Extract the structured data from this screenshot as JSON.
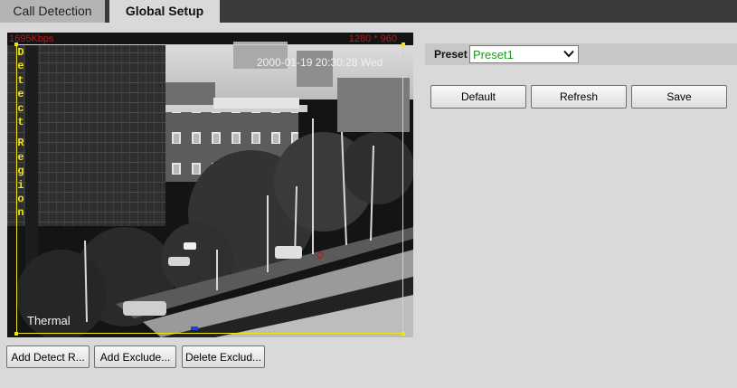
{
  "tabs": [
    {
      "label": "Call Detection",
      "active": false
    },
    {
      "label": "Global Setup",
      "active": true
    }
  ],
  "video": {
    "bitrate": "1695Kbps",
    "resolution": "1280 * 960",
    "timestamp": "2000-01-19 20:30:28 Wed",
    "channel_name": "Thermal",
    "region_label_lines": [
      "D",
      "e",
      "t",
      "e",
      "c",
      "t",
      "",
      "R",
      "e",
      "g",
      "i",
      "o",
      "n"
    ],
    "region_color": "#f2e21a",
    "overlay_color": "#d01010"
  },
  "bottom_buttons": {
    "add_detect": "Add Detect R...",
    "add_exclude": "Add Exclude...",
    "delete_exclude": "Delete Exclud..."
  },
  "preset": {
    "label": "Preset",
    "value": "Preset1",
    "value_color": "#1a9a1a"
  },
  "actions": {
    "default": "Default",
    "refresh": "Refresh",
    "save": "Save"
  }
}
